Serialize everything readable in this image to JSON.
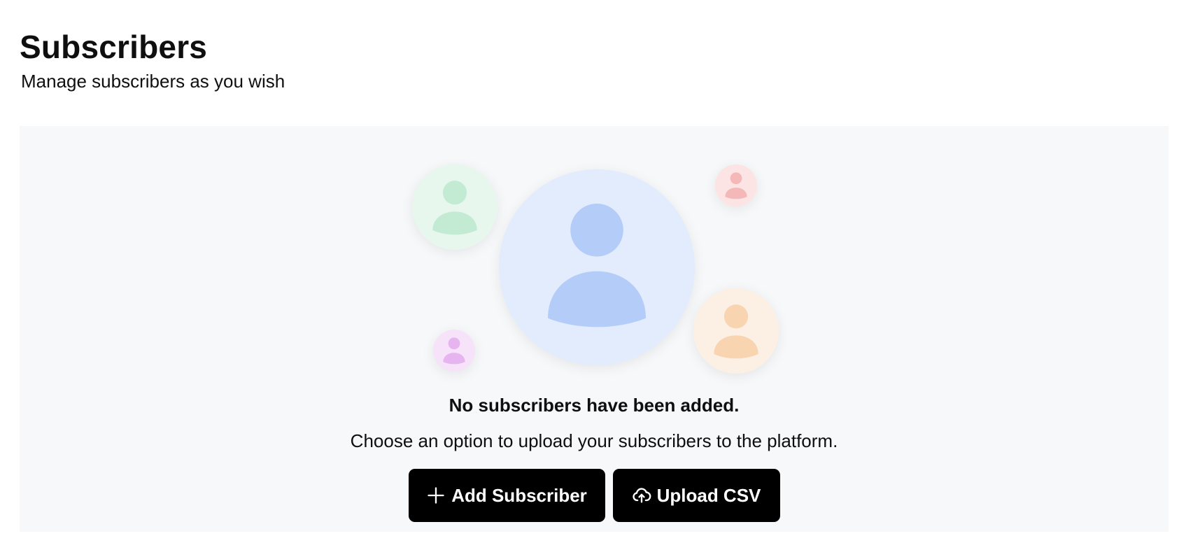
{
  "header": {
    "title": "Subscribers",
    "subtitle": "Manage subscribers as you wish"
  },
  "empty_state": {
    "title": "No subscribers have been added.",
    "description": "Choose an option to upload your subscribers to the platform.",
    "avatars": [
      {
        "name": "main",
        "bg": "#e3ecfd",
        "fg": "#b4cdf8"
      },
      {
        "name": "green",
        "bg": "#e8f7ee",
        "fg": "#c3ead3"
      },
      {
        "name": "red",
        "bg": "#fde4e4",
        "fg": "#f5b8b8"
      },
      {
        "name": "orange",
        "bg": "#fcefe3",
        "fg": "#f8d4b0"
      },
      {
        "name": "purple",
        "bg": "#f6e3f9",
        "fg": "#e6b4ef"
      }
    ]
  },
  "actions": {
    "add_label": "Add Subscriber",
    "add_icon": "plus-icon",
    "upload_label": "Upload CSV",
    "upload_icon": "cloud-upload-icon"
  }
}
